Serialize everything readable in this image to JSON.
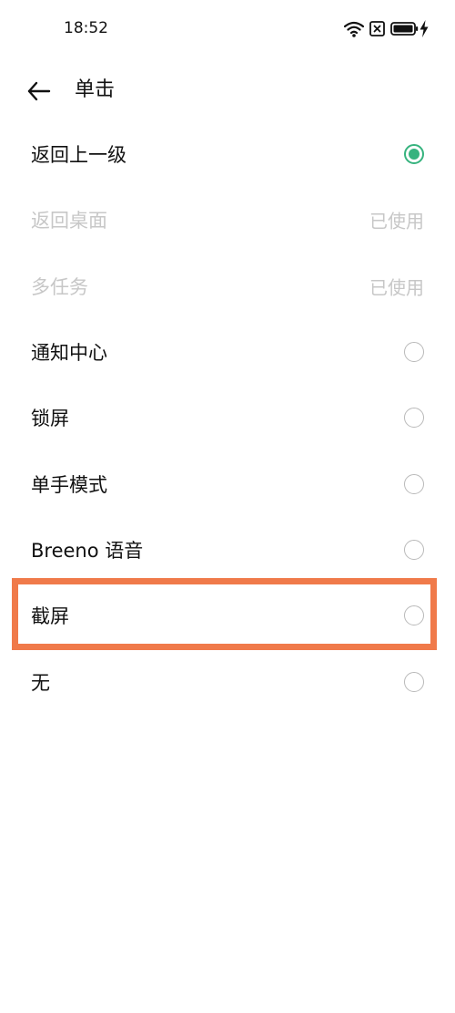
{
  "status_bar": {
    "time": "18:52",
    "icons": [
      "wifi-icon",
      "sim-disabled-icon",
      "battery-icon",
      "charging-icon"
    ]
  },
  "header": {
    "back_icon": "arrow-left-icon",
    "title": "单击"
  },
  "options": [
    {
      "label": "返回上一级",
      "state": "selected"
    },
    {
      "label": "返回桌面",
      "state": "used",
      "tag": "已使用"
    },
    {
      "label": "多任务",
      "state": "used",
      "tag": "已使用"
    },
    {
      "label": "通知中心",
      "state": "unselected"
    },
    {
      "label": "锁屏",
      "state": "unselected"
    },
    {
      "label": "单手模式",
      "state": "unselected"
    },
    {
      "label": "Breeno 语音",
      "state": "unselected"
    },
    {
      "label": "截屏",
      "state": "unselected",
      "highlighted": true
    },
    {
      "label": "无",
      "state": "unselected"
    }
  ],
  "colors": {
    "accent": "#36b37e",
    "disabled_text": "#c7c7c7",
    "highlight": "#f07a4a",
    "radio_border": "#b9b9b9"
  }
}
